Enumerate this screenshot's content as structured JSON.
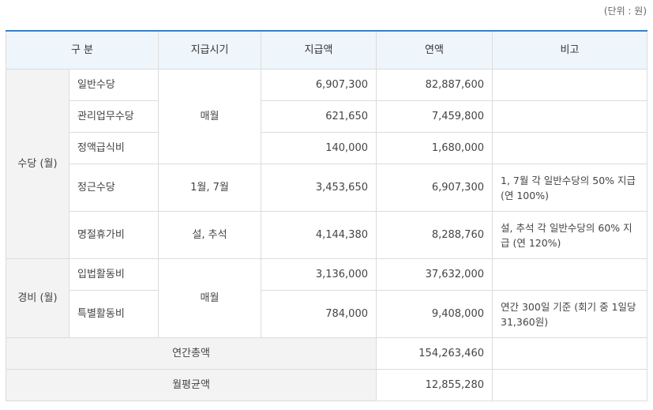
{
  "unit_label": "(단위 : 원)",
  "headers": [
    "구 분",
    "지급시기",
    "지급액",
    "연액",
    "비고"
  ],
  "groups": {
    "allowance": "수당 (월)",
    "expense": "경비 (월)"
  },
  "rows": [
    {
      "name": "일반수당",
      "amount": "6,907,300",
      "annual": "82,887,600",
      "note": ""
    },
    {
      "name": "관리업무수당",
      "amount": "621,650",
      "annual": "7,459,800",
      "note": ""
    },
    {
      "name": "정액급식비",
      "amount": "140,000",
      "annual": "1,680,000",
      "note": ""
    },
    {
      "name": "정근수당",
      "amount": "3,453,650",
      "annual": "6,907,300",
      "note": "1, 7월 각 일반수당의 50% 지급 (연 100%)"
    },
    {
      "name": "명절휴가비",
      "amount": "4,144,380",
      "annual": "8,288,760",
      "note": "설, 추석 각 일반수당의 60% 지급 (연 120%)"
    },
    {
      "name": "입법활동비",
      "amount": "3,136,000",
      "annual": "37,632,000",
      "note": ""
    },
    {
      "name": "특별활동비",
      "amount": "784,000",
      "annual": "9,408,000",
      "note": "연간 300일 기준 (회기 중 1일당 31,360원)"
    }
  ],
  "timing": {
    "monthly_1": "매월",
    "jan_jul": "1월, 7월",
    "holidays": "설, 추석",
    "monthly_2": "매월"
  },
  "totals": {
    "annual_label": "연간총액",
    "annual_value": "154,263,460",
    "monthly_label": "월평균액",
    "monthly_value": "12,855,280"
  }
}
